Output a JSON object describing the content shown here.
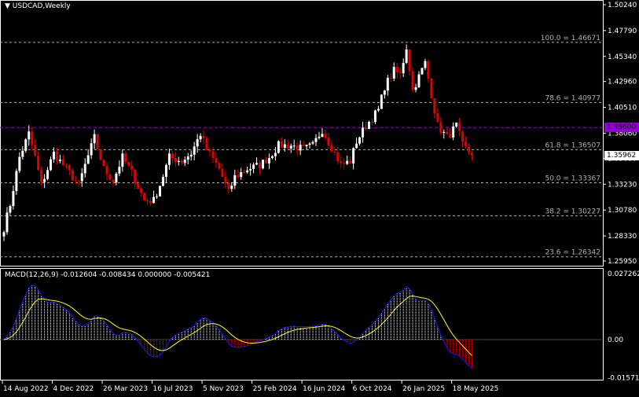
{
  "header": {
    "title": "USDCAD,Weekly",
    "menu_icon": "triangle-down-icon"
  },
  "macd_label": "MACD(12,26,9) -0.012604 -0.008434 0.000000 -0.005421",
  "price_tags": {
    "level_line": "1.38600",
    "current": "1.35962"
  },
  "colors": {
    "bull": "#ffffff",
    "bear": "#e00000",
    "macd": "#1a1aff",
    "signal": "#ffff00",
    "level": "#9400d3",
    "fib": "#b0b0b0",
    "grid": "#ffffff"
  },
  "chart_data": {
    "type": "candlestick",
    "symbol": "USDCAD",
    "timeframe": "Weekly",
    "price_axis": {
      "min": 1.2595,
      "max": 1.5024,
      "ticks": [
        "1.50240",
        "1.47790",
        "1.45340",
        "1.42960",
        "1.40510",
        "1.38060",
        "1.35680",
        "1.33230",
        "1.30780",
        "1.28330",
        "1.25950"
      ]
    },
    "x_ticks": [
      {
        "week": 0,
        "label": "14 Aug 2022"
      },
      {
        "week": 16,
        "label": "4 Dec 2022"
      },
      {
        "week": 32,
        "label": "26 Mar 2023"
      },
      {
        "week": 48,
        "label": "16 Jul 2023"
      },
      {
        "week": 64,
        "label": "5 Nov 2023"
      },
      {
        "week": 80,
        "label": "25 Feb 2024"
      },
      {
        "week": 96,
        "label": "16 Jun 2024"
      },
      {
        "week": 112,
        "label": "6 Oct 2024"
      },
      {
        "week": 128,
        "label": "26 Jan 2025"
      },
      {
        "week": 144,
        "label": "18 May 2025"
      }
    ],
    "weeks": 151,
    "close_path": [
      [
        0,
        1.2908
      ],
      [
        2,
        1.3132
      ],
      [
        5,
        1.3579
      ],
      [
        8,
        1.3802
      ],
      [
        10,
        1.3579
      ],
      [
        12,
        1.3318
      ],
      [
        16,
        1.3616
      ],
      [
        20,
        1.3467
      ],
      [
        24,
        1.3318
      ],
      [
        26,
        1.3504
      ],
      [
        29,
        1.3765
      ],
      [
        32,
        1.3467
      ],
      [
        35,
        1.3355
      ],
      [
        38,
        1.3579
      ],
      [
        41,
        1.343
      ],
      [
        45,
        1.3169
      ],
      [
        48,
        1.3169
      ],
      [
        50,
        1.3318
      ],
      [
        53,
        1.3579
      ],
      [
        57,
        1.3541
      ],
      [
        60,
        1.3616
      ],
      [
        63,
        1.3802
      ],
      [
        65,
        1.3653
      ],
      [
        69,
        1.3467
      ],
      [
        72,
        1.3243
      ],
      [
        74,
        1.3392
      ],
      [
        78,
        1.3467
      ],
      [
        82,
        1.3504
      ],
      [
        85,
        1.3579
      ],
      [
        88,
        1.369
      ],
      [
        92,
        1.369
      ],
      [
        96,
        1.3653
      ],
      [
        99,
        1.369
      ],
      [
        102,
        1.3839
      ],
      [
        106,
        1.3616
      ],
      [
        108,
        1.3504
      ],
      [
        111,
        1.3541
      ],
      [
        113,
        1.3728
      ],
      [
        116,
        1.3877
      ],
      [
        120,
        1.4026
      ],
      [
        122,
        1.4249
      ],
      [
        125,
        1.4398
      ],
      [
        127,
        1.4361
      ],
      [
        129,
        1.4622
      ],
      [
        131,
        1.4212
      ],
      [
        135,
        1.4473
      ],
      [
        137,
        1.4175
      ],
      [
        139,
        1.3877
      ],
      [
        142,
        1.3765
      ],
      [
        145,
        1.3877
      ],
      [
        147,
        1.369
      ],
      [
        150,
        1.3596
      ]
    ],
    "fib_levels": [
      {
        "label": "100.0 = 1.46671",
        "price": 1.46671
      },
      {
        "label": "78.6 = 1.40977",
        "price": 1.40977
      },
      {
        "label": "61.8 = 1.36507",
        "price": 1.36507
      },
      {
        "label": "50.0 = 1.33367",
        "price": 1.33367
      },
      {
        "label": "38.2 = 1.30227",
        "price": 1.30227
      },
      {
        "label": "23.6 = 1.26342",
        "price": 1.26342
      }
    ],
    "horizontal_line": 1.386,
    "current_price": 1.35962,
    "macd": {
      "fast": 12,
      "slow": 26,
      "signal": 9,
      "axis": {
        "min": -0.015718,
        "max": 0.027262,
        "ticks": [
          "0.027262",
          "0.00",
          "-0.015718"
        ]
      }
    }
  }
}
